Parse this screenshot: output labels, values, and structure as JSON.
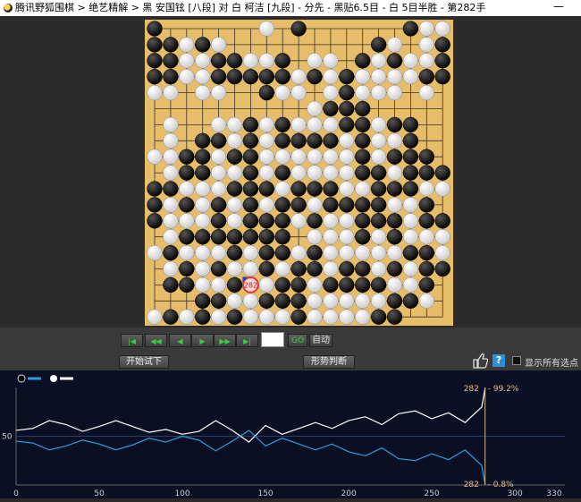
{
  "window": {
    "title": "腾讯野狐围棋 > 绝艺精解 > 黑 安国铉 [八段] 对 白 柯洁 [九段] - 分先 - 黑贴6.5目 - 白 5目半胜 - 第282手"
  },
  "board": {
    "size": 19,
    "rows": [
      "B......W.B......BWW",
      "BBWBW.........BW.WB",
      "BBWWBBWWB.WW.BWBWWB",
      "BBWWBBBBBWBWBWWWWBB",
      "WW.WW..BWW.WBWWW.W.",
      "..........WBBB.....",
      ".W..WWBWBWWWBBWBB..",
      ".W.BBWBWBBBBWBWWB..",
      "WWBBWBBWWWWWWBWBBB.",
      ".WBBWWBWBWWWWBBWBBB",
      "BBWWWBBBWBBBWWBBBWW",
      "BWBWBWBWBBWBBBBWWB.",
      "BWWWBWBBBWBWWBBBWBB",
      ".WBBBBBBB.WWWBWBWWW",
      "WBWWWBWBBWBWWWWWBBW",
      ".WBWBWWBWBBWBBWBWBB",
      ".BBWWBWWBBWBBBBWWB.",
      "...BBWWBBBWWWWWBBW.",
      "WBWBWBWWWBWWWWBB..."
    ],
    "last_move": {
      "row": 16,
      "col": 6,
      "number": "282"
    }
  },
  "controls": {
    "nav_first": "|◀",
    "nav_back_fast": "◀◀",
    "nav_back": "◀",
    "nav_forward": "▶",
    "nav_forward_fast": "▶▶",
    "nav_last": "▶|",
    "move_input": "",
    "go_label": "GO",
    "auto_label": "自动",
    "start_trial_label": "开始试下",
    "situation_label": "形势判断",
    "show_all_points_label": "显示所有选点"
  },
  "chart_data": {
    "type": "line",
    "xlabel": "",
    "ylabel": "",
    "xlim": [
      0,
      330
    ],
    "ylim": [
      0,
      100
    ],
    "x_ticks": [
      0,
      50,
      100,
      150,
      200,
      250,
      300,
      330
    ],
    "y_ticks": [
      0,
      50,
      100
    ],
    "series": [
      {
        "color": "#ffffff",
        "x": [
          0,
          10,
          20,
          30,
          40,
          50,
          60,
          70,
          80,
          90,
          100,
          110,
          120,
          130,
          140,
          150,
          160,
          170,
          180,
          190,
          200,
          210,
          220,
          230,
          240,
          250,
          260,
          270,
          280,
          282
        ],
        "y": [
          56,
          58,
          66,
          62,
          55,
          60,
          66,
          60,
          54,
          57,
          52,
          55,
          66,
          56,
          44,
          61,
          52,
          58,
          64,
          58,
          66,
          70,
          62,
          73,
          76,
          68,
          74,
          64,
          80,
          99.2
        ]
      },
      {
        "color": "#2a9ee0",
        "x": [
          0,
          10,
          20,
          30,
          40,
          50,
          60,
          70,
          80,
          90,
          100,
          110,
          120,
          130,
          140,
          150,
          160,
          170,
          180,
          190,
          200,
          210,
          220,
          230,
          240,
          250,
          260,
          270,
          280,
          282
        ],
        "y": [
          45,
          43,
          36,
          40,
          46,
          42,
          36,
          41,
          48,
          44,
          50,
          46,
          35,
          45,
          56,
          40,
          48,
          42,
          36,
          42,
          34,
          30,
          38,
          27,
          25,
          32,
          26,
          36,
          20,
          0.8
        ]
      }
    ],
    "legend": [
      "black",
      "white"
    ],
    "annotations": [
      {
        "move": "282",
        "value": "99.2%"
      },
      {
        "move": "282",
        "value": "0.8%"
      }
    ]
  }
}
